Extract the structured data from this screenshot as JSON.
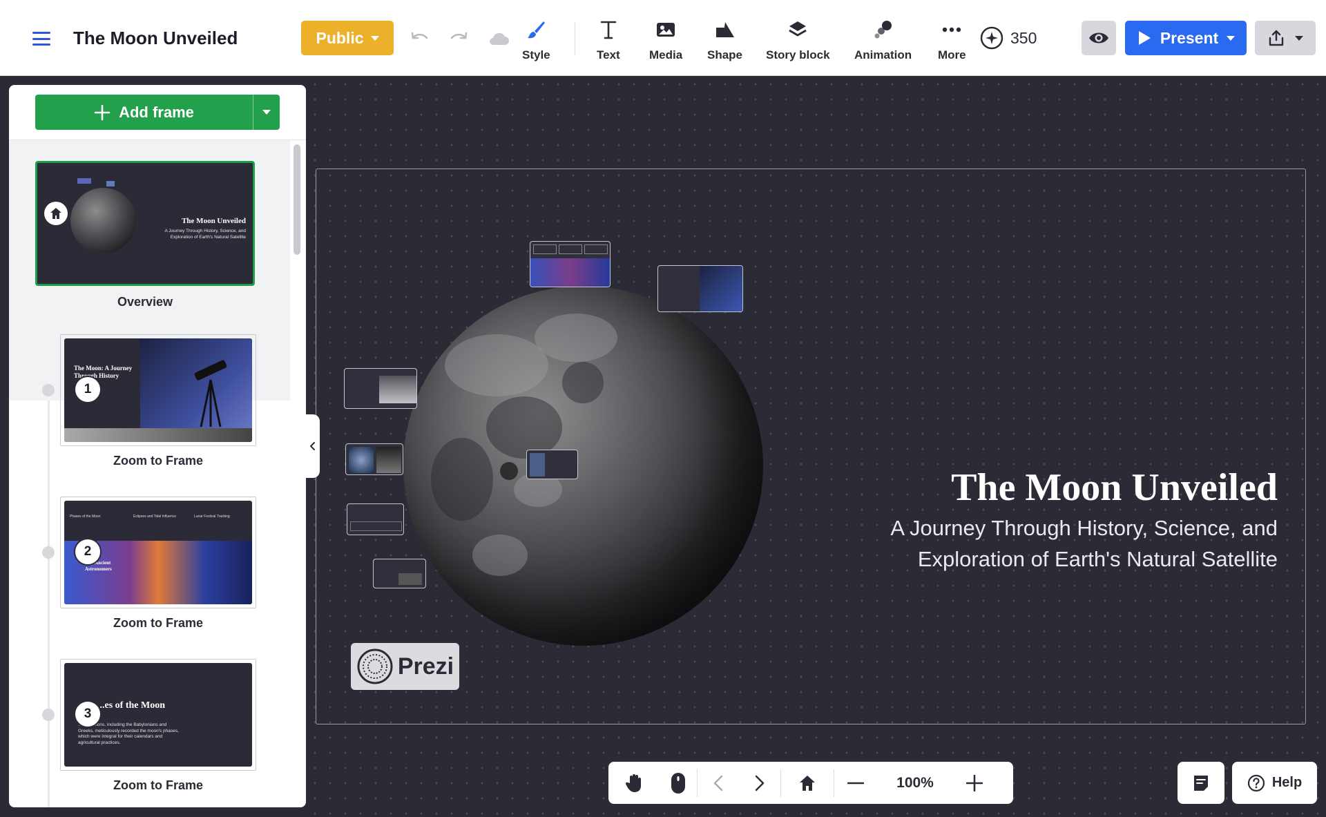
{
  "header": {
    "title": "The Moon Unveiled",
    "visibility_label": "Public",
    "tools": {
      "style": "Style",
      "text": "Text",
      "media": "Media",
      "shape": "Shape",
      "story_block": "Story block",
      "animation": "Animation",
      "more": "More"
    },
    "credits": "350",
    "present_label": "Present"
  },
  "sidebar": {
    "add_frame_label": "Add frame",
    "overview": {
      "label": "Overview",
      "thumb_title": "The Moon Unveiled",
      "thumb_subtitle": "A Journey Through History, Science, and Exploration of Earth's Natural Satellite"
    },
    "frames": [
      {
        "number": "1",
        "label": "Zoom to Frame",
        "thumb_title": "The Moon: A Journey Through History"
      },
      {
        "number": "2",
        "label": "Zoom to Frame",
        "thumb_title": "...by Ancient Astronomers",
        "columns": [
          "Phases of the Moon",
          "Eclipses and Tidal Influence",
          "Lunar Festival Tracking"
        ]
      },
      {
        "number": "3",
        "label": "Zoom to Frame",
        "thumb_title": "...es of the Moon",
        "thumb_body": "...civilizations, including the Babylonians and Greeks, meticulously recorded the moon's phases, which were integral for their calendars and agricultural practices."
      }
    ]
  },
  "canvas": {
    "title": "The Moon Unveiled",
    "subtitle": "A Journey Through History, Science, and Exploration of Earth's Natural Satellite",
    "brand": "Prezi"
  },
  "controls": {
    "zoom": "100%",
    "help_label": "Help"
  },
  "colors": {
    "public": "#ecb02b",
    "present": "#2a6af0",
    "add_frame": "#22a04b",
    "canvas_bg": "#2b2b36",
    "accent_blue": "#2c57d6"
  }
}
